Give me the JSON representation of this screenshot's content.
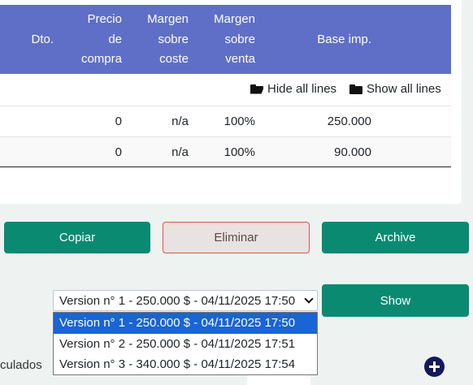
{
  "table": {
    "headers": {
      "dto": "Dto.",
      "precio_compra": [
        "Precio",
        "de",
        "compra"
      ],
      "margen_coste": [
        "Margen",
        "sobre",
        "coste"
      ],
      "margen_venta": [
        "Margen",
        "sobre",
        "venta"
      ],
      "base_imp": "Base imp."
    },
    "toolbar": {
      "hide_all": "Hide all lines",
      "show_all": "Show all lines"
    },
    "rows": [
      {
        "precio_compra": "0",
        "margen_coste": "n/a",
        "margen_venta": "100%",
        "base_imp": "250.000"
      },
      {
        "precio_compra": "0",
        "margen_coste": "n/a",
        "margen_venta": "100%",
        "base_imp": "90.000"
      }
    ]
  },
  "actions": {
    "copy": "Copiar",
    "delete": "Eliminar",
    "archive": "Archive"
  },
  "versions": {
    "selected": "Version n° 1 - 250.000 $ - 04/11/2025 17:50",
    "options": [
      "Version n° 1 - 250.000 $ - 04/11/2025 17:50",
      "Version n° 2 - 250.000 $ - 04/11/2025 17:51",
      "Version n° 3 - 340.000 $ - 04/11/2025 17:54"
    ],
    "show_label": "Show"
  },
  "footer": {
    "truncated_label": "culados"
  },
  "colors": {
    "header_bg": "#5f6fc7",
    "primary": "#0b8a72",
    "danger_border": "#e2524b",
    "selected_option": "#1a64d4"
  }
}
